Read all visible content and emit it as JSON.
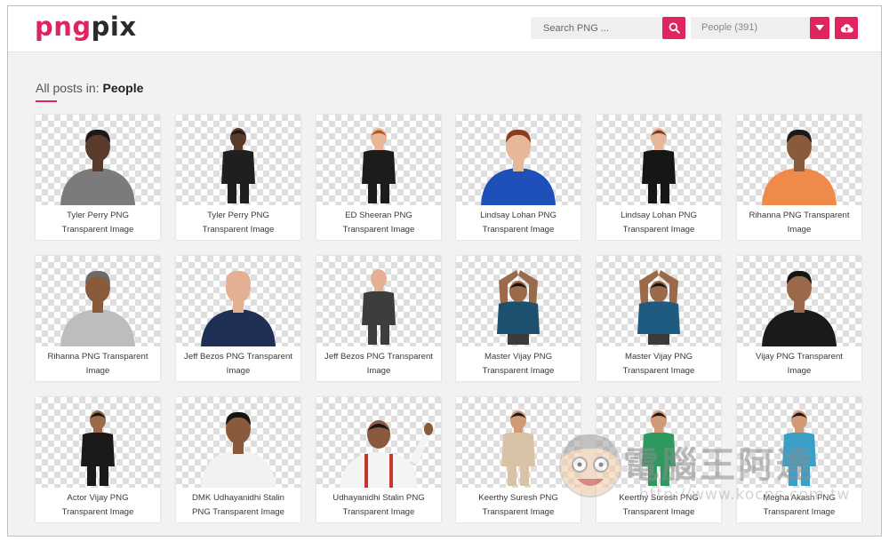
{
  "logo": {
    "part1": "png",
    "part2": "pix"
  },
  "search": {
    "placeholder": "Search PNG ..."
  },
  "category_select": {
    "value": "People  (391)"
  },
  "heading": {
    "prefix": "All posts in: ",
    "category": "People"
  },
  "colors": {
    "accent": "#e0245e",
    "text": "#333333",
    "checker": "#dedede"
  },
  "icons": {
    "search": "magnifier-icon",
    "dropdown": "caret-down-icon",
    "upload": "cloud-upload-icon"
  },
  "cards": [
    {
      "line1": "Tyler Perry PNG",
      "line2": "Transparent Image",
      "shirt": "#7b7b7b",
      "skin": "#5a3a2a",
      "hair": "#1a1a1a",
      "pose": "bust"
    },
    {
      "line1": "Tyler Perry PNG",
      "line2": "Transparent Image",
      "shirt": "#1f1f1f",
      "skin": "#5a3a2a",
      "hair": "#1a1a1a",
      "pose": "standing"
    },
    {
      "line1": "ED Sheeran PNG",
      "line2": "Transparent Image",
      "shirt": "#1c1c1c",
      "skin": "#e8b79a",
      "hair": "#b5541e",
      "pose": "standing"
    },
    {
      "line1": "Lindsay Lohan PNG",
      "line2": "Transparent Image",
      "shirt": "#1f4fb8",
      "skin": "#e6b899",
      "hair": "#8a3d1f",
      "pose": "bust"
    },
    {
      "line1": "Lindsay Lohan PNG",
      "line2": "Transparent Image",
      "shirt": "#161616",
      "skin": "#e6b899",
      "hair": "#7a3d22",
      "pose": "standing"
    },
    {
      "line1": "Rihanna PNG Transparent",
      "line2": "Image",
      "shirt": "#f08a4b",
      "skin": "#8a5a3c",
      "hair": "#1a1a1a",
      "pose": "bust"
    },
    {
      "line1": "Rihanna PNG Transparent",
      "line2": "Image",
      "shirt": "#bdbdbd",
      "skin": "#8a5a3c",
      "hair": "#6b6b6b",
      "pose": "bust"
    },
    {
      "line1": "Jeff Bezos PNG Transparent",
      "line2": "Image",
      "shirt": "#1f2f55",
      "skin": "#e3b093",
      "hair": "#e3b093",
      "pose": "bust"
    },
    {
      "line1": "Jeff Bezos PNG Transparent",
      "line2": "Image",
      "shirt": "#3d3d3d",
      "skin": "#e3b093",
      "hair": "#e3b093",
      "pose": "standing"
    },
    {
      "line1": "Master Vijay PNG",
      "line2": "Transparent Image",
      "shirt": "#1d4f6e",
      "skin": "#9a6a4a",
      "hair": "#151515",
      "pose": "arms-up"
    },
    {
      "line1": "Master Vijay PNG",
      "line2": "Transparent Image",
      "shirt": "#1f5a80",
      "skin": "#9a6a4a",
      "hair": "#151515",
      "pose": "arms-up"
    },
    {
      "line1": "Vijay PNG Transparent",
      "line2": "Image",
      "shirt": "#1a1a1a",
      "skin": "#9a6a4a",
      "hair": "#151515",
      "pose": "bust"
    },
    {
      "line1": "Actor Vijay PNG",
      "line2": "Transparent Image",
      "shirt": "#1a1a1a",
      "skin": "#9a6a4a",
      "hair": "#151515",
      "pose": "standing"
    },
    {
      "line1": "DMK Udhayanidhi Stalin",
      "line2": "PNG Transparent Image",
      "shirt": "#f2f2f2",
      "skin": "#8a5a3c",
      "hair": "#151515",
      "pose": "bust"
    },
    {
      "line1": "Udhayanidhi Stalin PNG",
      "line2": "Transparent Image",
      "shirt": "#f4f4f4",
      "skin": "#8a5a3c",
      "hair": "#151515",
      "pose": "wave"
    },
    {
      "line1": "Keerthy Suresh PNG",
      "line2": "Transparent Image",
      "shirt": "#d9c3a6",
      "skin": "#d19a76",
      "hair": "#1a1a1a",
      "pose": "standing"
    },
    {
      "line1": "Keerthy Suresh PNG",
      "line2": "Transparent Image",
      "shirt": "#2f9a60",
      "skin": "#d19a76",
      "hair": "#1a1a1a",
      "pose": "standing"
    },
    {
      "line1": "Megha Akash PNG",
      "line2": "Transparent Image",
      "shirt": "#3aa0c8",
      "skin": "#d19a76",
      "hair": "#1a1a1a",
      "pose": "standing"
    }
  ],
  "watermark": {
    "text": "電腦王阿達",
    "url": "http://www.kocpc.com.tw"
  }
}
